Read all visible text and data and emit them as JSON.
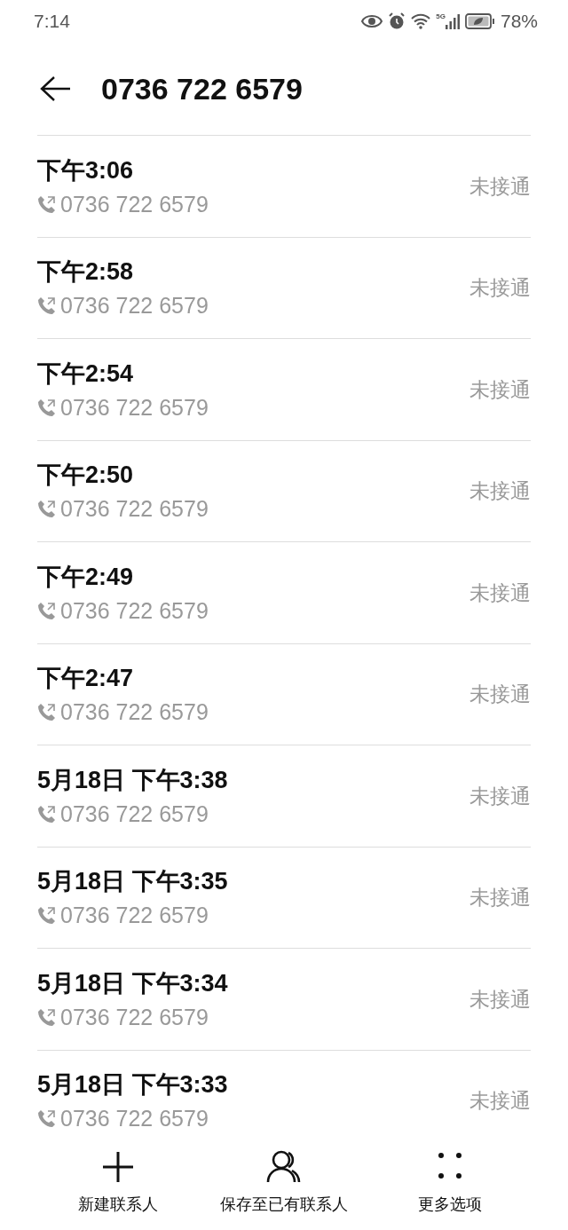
{
  "status_bar": {
    "time": "7:14",
    "network": "5G",
    "battery": "78%"
  },
  "header": {
    "title": "0736 722 6579"
  },
  "calls": [
    {
      "time": "下午3:06",
      "number": "0736 722 6579",
      "status": "未接通"
    },
    {
      "time": "下午2:58",
      "number": "0736 722 6579",
      "status": "未接通"
    },
    {
      "time": "下午2:54",
      "number": "0736 722 6579",
      "status": "未接通"
    },
    {
      "time": "下午2:50",
      "number": "0736 722 6579",
      "status": "未接通"
    },
    {
      "time": "下午2:49",
      "number": "0736 722 6579",
      "status": "未接通"
    },
    {
      "time": "下午2:47",
      "number": "0736 722 6579",
      "status": "未接通"
    },
    {
      "time": "5月18日 下午3:38",
      "number": "0736 722 6579",
      "status": "未接通"
    },
    {
      "time": "5月18日 下午3:35",
      "number": "0736 722 6579",
      "status": "未接通"
    },
    {
      "time": "5月18日 下午3:34",
      "number": "0736 722 6579",
      "status": "未接通"
    },
    {
      "time": "5月18日 下午3:33",
      "number": "0736 722 6579",
      "status": "未接通"
    }
  ],
  "actions": [
    {
      "kind": "add",
      "label": "新建联系人"
    },
    {
      "kind": "contact",
      "label": "保存至已有联系人"
    },
    {
      "kind": "more",
      "label": "更多选项"
    }
  ]
}
